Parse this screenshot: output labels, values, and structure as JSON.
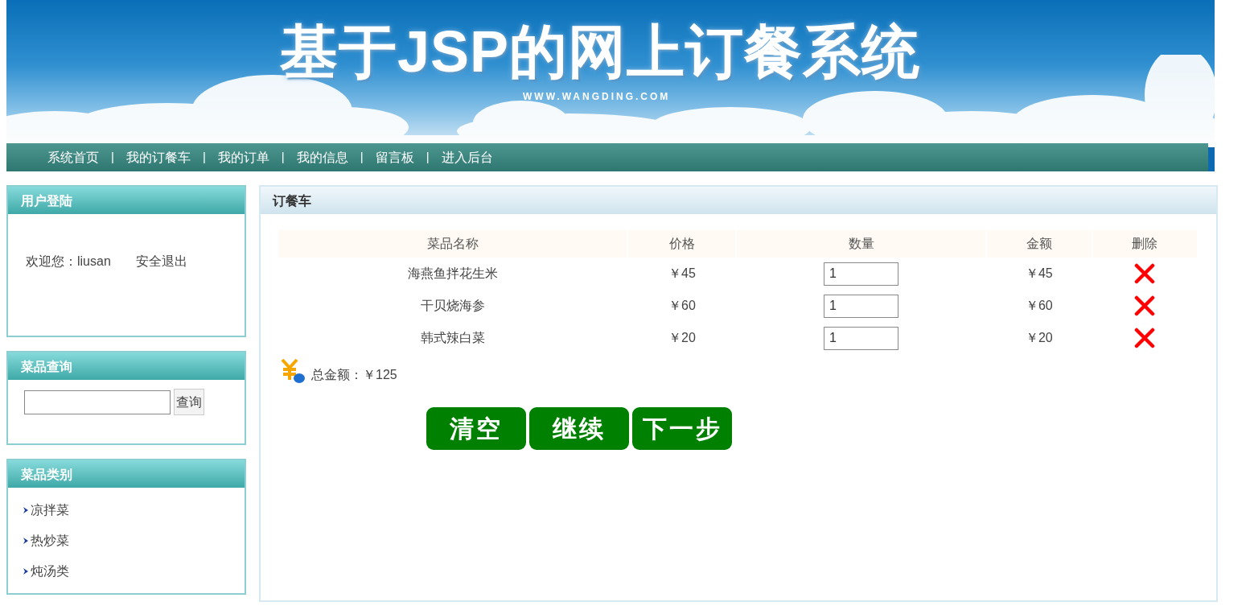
{
  "banner": {
    "title": "基于JSP的网上订餐系统",
    "url": "WWW.WANGDING.COM"
  },
  "nav": {
    "separator": "|",
    "items": [
      "系统首页",
      "我的订餐车",
      "我的订单",
      "我的信息",
      "留言板",
      "进入后台"
    ]
  },
  "login_panel": {
    "title": "用户登陆",
    "welcome": "欢迎您：liusan",
    "logout": "安全退出"
  },
  "search_panel": {
    "title": "菜品查询",
    "button": "查询"
  },
  "category_panel": {
    "title": "菜品类别",
    "items": [
      "凉拌菜",
      "热炒菜",
      "炖汤类"
    ]
  },
  "cart": {
    "title": "订餐车",
    "columns": [
      "菜品名称",
      "价格",
      "数量",
      "金额",
      "删除"
    ],
    "rows": [
      {
        "name": "海燕鱼拌花生米",
        "price": "￥45",
        "quantity": "1",
        "amount": "￥45"
      },
      {
        "name": "干贝烧海参",
        "price": "￥60",
        "quantity": "1",
        "amount": "￥60"
      },
      {
        "name": "韩式辣白菜",
        "price": "￥20",
        "quantity": "1",
        "amount": "￥20"
      }
    ],
    "total": "总金额：￥125",
    "buttons": [
      "清空",
      "继续",
      "下一步"
    ]
  }
}
